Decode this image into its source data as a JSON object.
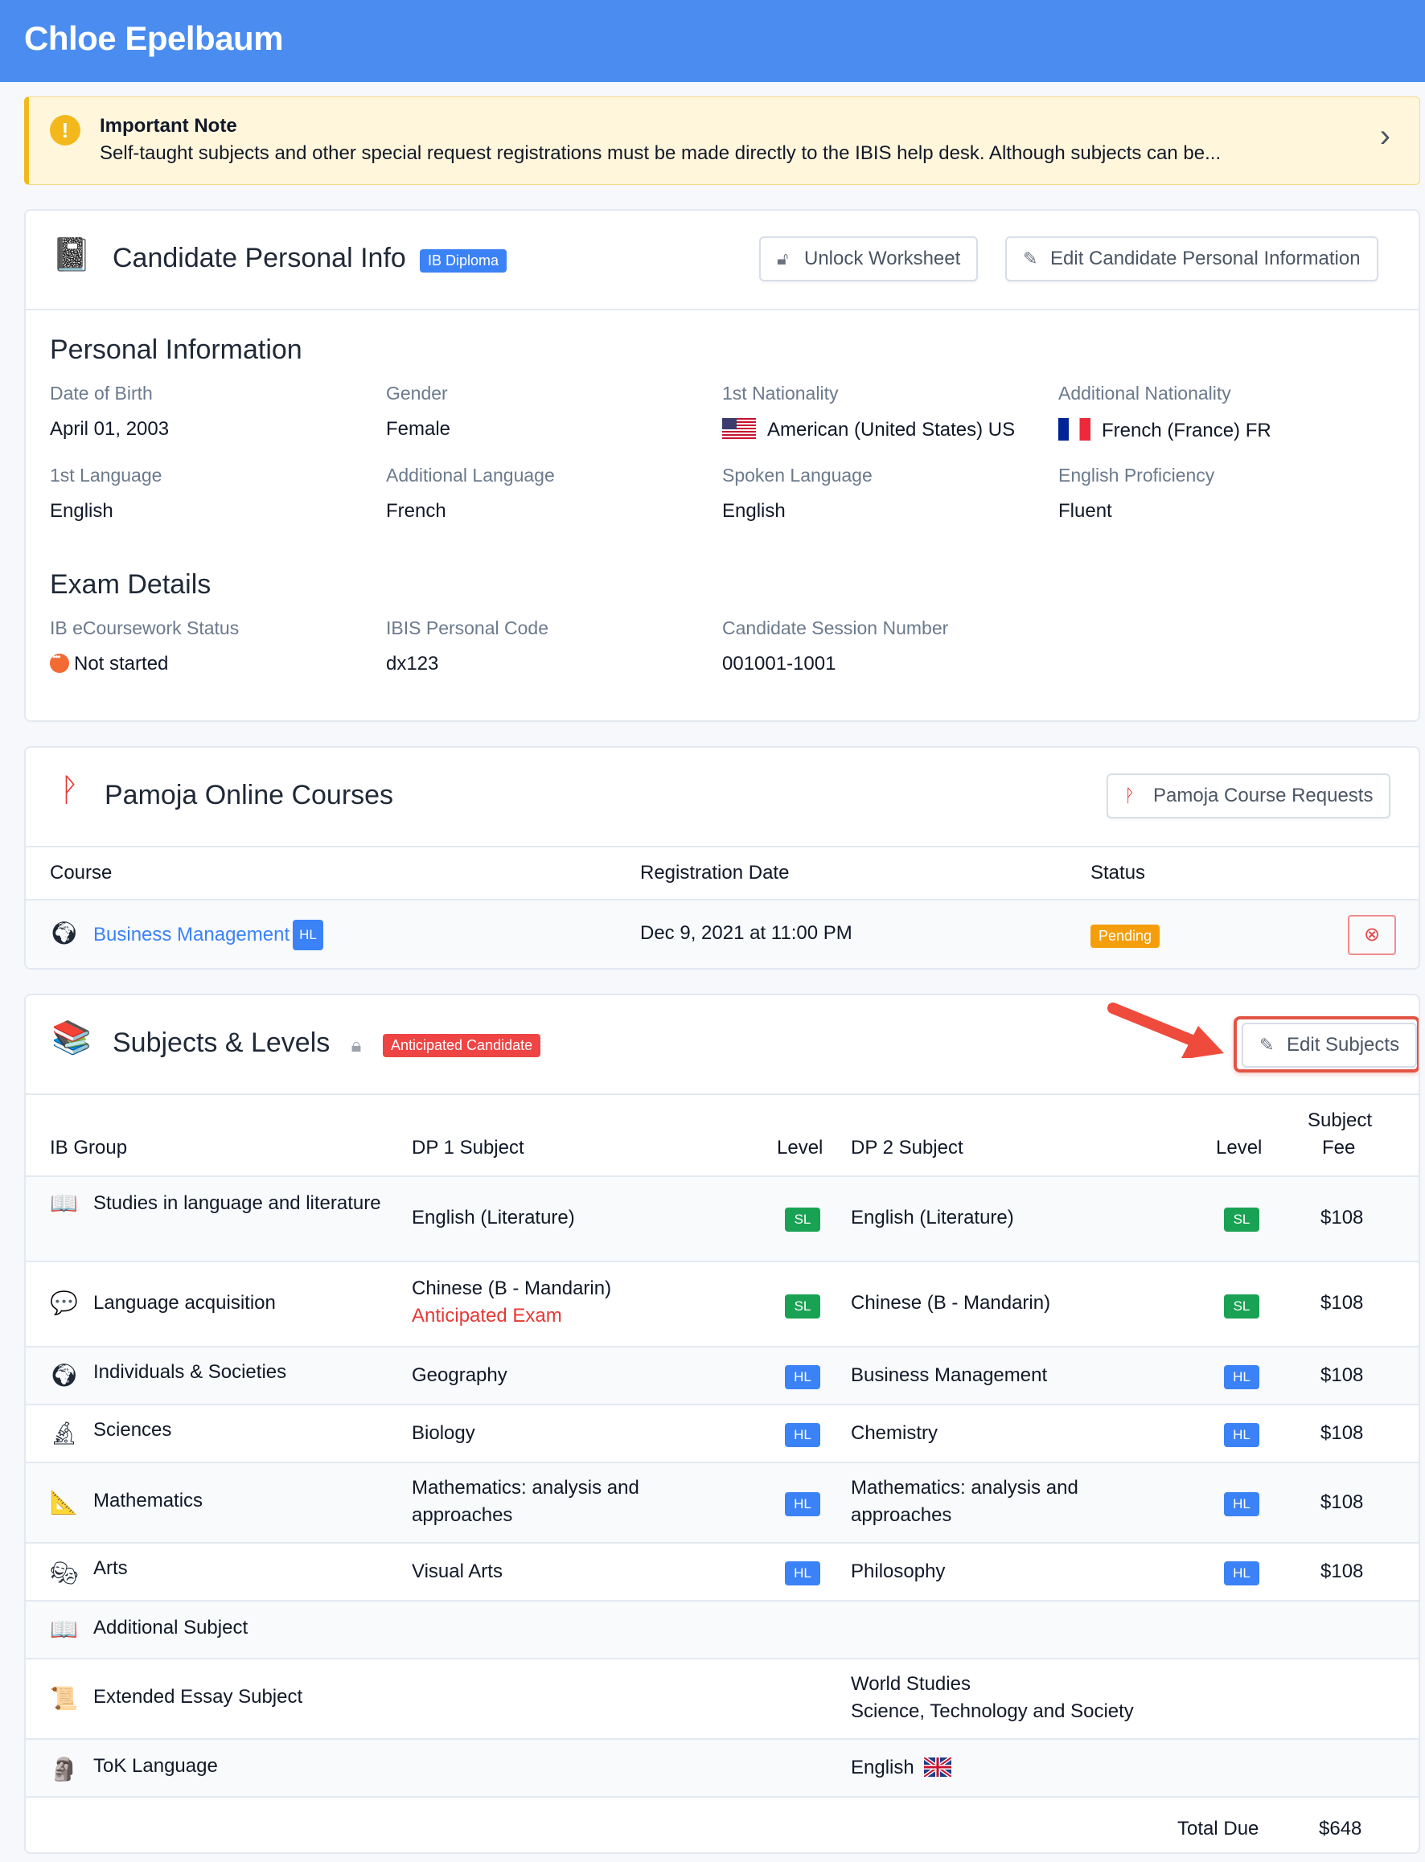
{
  "header": {
    "title": "Chloe Epelbaum"
  },
  "note": {
    "title": "Important Note",
    "text": "Self-taught subjects and other special request registrations must be made directly to the IBIS help desk. Although subjects can be..."
  },
  "candidate": {
    "title": "Candidate Personal Info",
    "badge": "IB Diploma",
    "unlock_label": "Unlock Worksheet",
    "edit_label": "Edit Candidate Personal Information",
    "personal_heading": "Personal Information",
    "fields": {
      "dob_label": "Date of Birth",
      "dob": "April 01, 2003",
      "gender_label": "Gender",
      "gender": "Female",
      "nat1_label": "1st Nationality",
      "nat1": "American (United States) US",
      "nat2_label": "Additional Nationality",
      "nat2": "French (France) FR",
      "lang1_label": "1st Language",
      "lang1": "English",
      "lang2_label": "Additional Language",
      "lang2": "French",
      "spoken_label": "Spoken Language",
      "spoken": "English",
      "prof_label": "English Proficiency",
      "prof": "Fluent"
    },
    "exam_heading": "Exam Details",
    "exam": {
      "ecw_label": "IB eCoursework Status",
      "ecw": "Not started",
      "code_label": "IBIS Personal Code",
      "code": "dx123",
      "session_label": "Candidate Session Number",
      "session": "001001-1001"
    }
  },
  "pamoja": {
    "title": "Pamoja Online Courses",
    "requests_label": "Pamoja Course Requests",
    "columns": {
      "course": "Course",
      "date": "Registration Date",
      "status": "Status"
    },
    "row": {
      "course": "Business Management",
      "level": "HL",
      "date": "Dec 9, 2021 at 11:00 PM",
      "status": "Pending"
    }
  },
  "subjects": {
    "title": "Subjects & Levels",
    "badge": "Anticipated Candidate",
    "edit_label": "Edit Subjects",
    "columns": {
      "group": "IB Group",
      "dp1": "DP 1 Subject",
      "level1": "Level",
      "dp2": "DP 2 Subject",
      "level2": "Level",
      "fee_line1": "Subject",
      "fee_line2": "Fee"
    },
    "rows": [
      {
        "icon": "book-icon",
        "group": "Studies in language and literature",
        "dp1": "English (Literature)",
        "l1": "SL",
        "dp2": "English (Literature)",
        "l2": "SL",
        "fee": "$108"
      },
      {
        "icon": "speech-bubble-icon",
        "group": "Language acquisition",
        "dp1": "Chinese (B - Mandarin)",
        "dp1_note": "Anticipated Exam",
        "l1": "SL",
        "dp2": "Chinese (B - Mandarin)",
        "l2": "SL",
        "fee": "$108"
      },
      {
        "icon": "globe-icon",
        "group": "Individuals & Societies",
        "dp1": "Geography",
        "l1": "HL",
        "dp2": "Business Management",
        "l2": "HL",
        "fee": "$108"
      },
      {
        "icon": "microscope-icon",
        "group": "Sciences",
        "dp1": "Biology",
        "l1": "HL",
        "dp2": "Chemistry",
        "l2": "HL",
        "fee": "$108"
      },
      {
        "icon": "compass-icon",
        "group": "Mathematics",
        "dp1": "Mathematics: analysis and approaches",
        "l1": "HL",
        "dp2": "Mathematics: analysis and approaches",
        "l2": "HL",
        "fee": "$108"
      },
      {
        "icon": "theater-masks-icon",
        "group": "Arts",
        "dp1": "Visual Arts",
        "l1": "HL",
        "dp2": "Philosophy",
        "l2": "HL",
        "fee": "$108"
      },
      {
        "icon": "book-icon",
        "group": "Additional Subject"
      },
      {
        "icon": "scroll-icon",
        "group": "Extended Essay Subject",
        "dp2_line1": "World Studies",
        "dp2_line2": "Science, Technology and Society"
      },
      {
        "icon": "thinker-icon",
        "group": "ToK Language",
        "dp2": "English"
      }
    ],
    "total_label": "Total Due",
    "total": "$648"
  },
  "colors": {
    "topbar": "#4a8cf0",
    "accent": "#3b82f6",
    "sl": "#1aa254",
    "hl": "#3b82f6",
    "pending": "#f59e0b",
    "danger": "#e53935"
  }
}
